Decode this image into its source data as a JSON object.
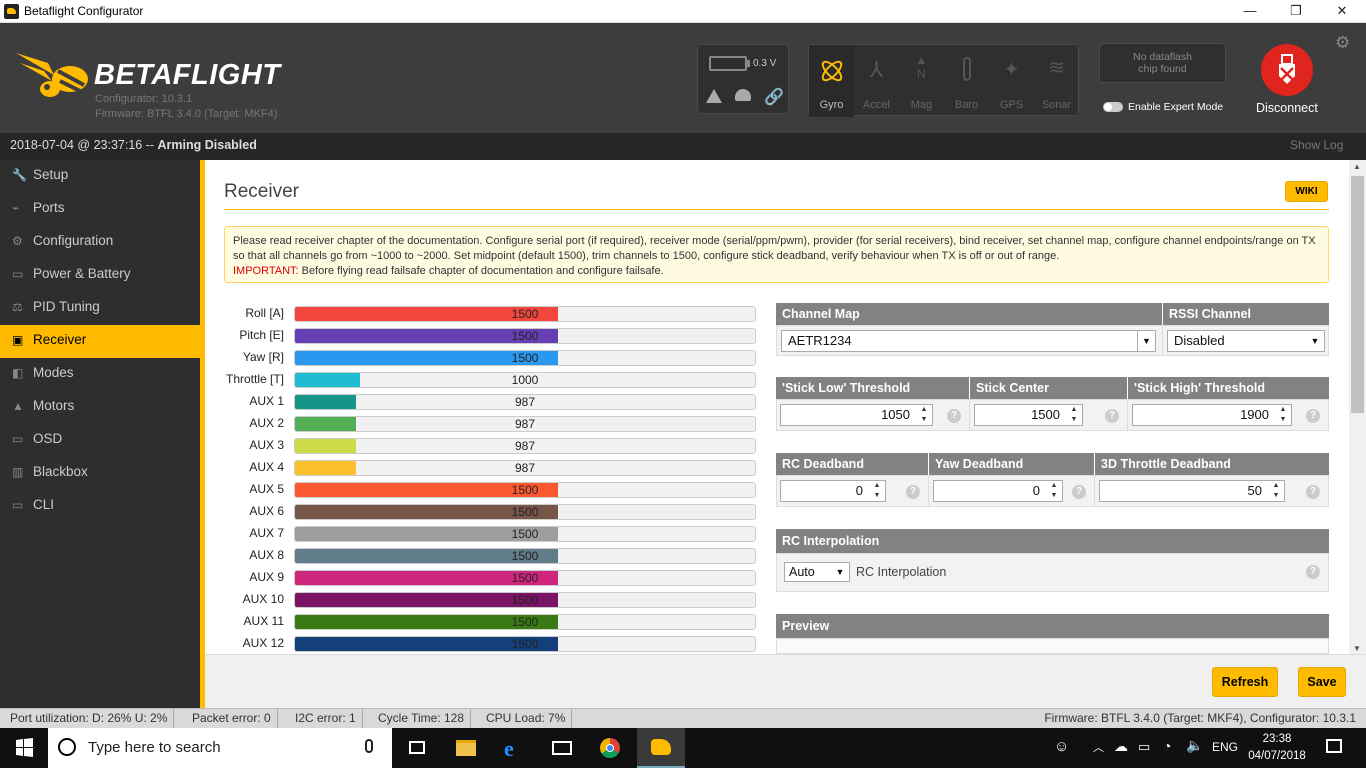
{
  "window": {
    "title": "Betaflight Configurator",
    "minimize": "—",
    "maximize": "❐",
    "close": "✕"
  },
  "header": {
    "logo_main": "BETA",
    "logo_flight": "FLIGHT",
    "configurator_version": "Configurator: 10.3.1",
    "firmware": "Firmware: BTFL 3.4.0 (Target: MKF4)",
    "battery_voltage": "0.3 V",
    "sensors": [
      {
        "label": "Gyro",
        "icon": "gyro-icon",
        "active": true
      },
      {
        "label": "Accel",
        "icon": "accel-icon",
        "active": false
      },
      {
        "label": "Mag",
        "icon": "mag-icon",
        "active": false
      },
      {
        "label": "Baro",
        "icon": "baro-icon",
        "active": false
      },
      {
        "label": "GPS",
        "icon": "gps-icon",
        "active": false
      },
      {
        "label": "Sonar",
        "icon": "sonar-icon",
        "active": false
      }
    ],
    "dataflash_line1": "No dataflash",
    "dataflash_line2": "chip found",
    "expert_mode_label": "Enable Expert Mode",
    "disconnect_label": "Disconnect"
  },
  "status": {
    "datetime": "2018-07-04 @ 23:37:16 -- ",
    "arming": "Arming Disabled",
    "show_log": "Show Log"
  },
  "nav": [
    {
      "label": "Setup",
      "icon": "wrench-icon",
      "glyph": "🔧"
    },
    {
      "label": "Ports",
      "icon": "plug-icon",
      "glyph": "⌁"
    },
    {
      "label": "Configuration",
      "icon": "gear-icon",
      "glyph": "⚙"
    },
    {
      "label": "Power & Battery",
      "icon": "battery-icon",
      "glyph": "▭"
    },
    {
      "label": "PID Tuning",
      "icon": "pid-icon",
      "glyph": "⚖"
    },
    {
      "label": "Receiver",
      "icon": "receiver-icon",
      "glyph": "▣",
      "active": true
    },
    {
      "label": "Modes",
      "icon": "modes-icon",
      "glyph": "◧"
    },
    {
      "label": "Motors",
      "icon": "motor-icon",
      "glyph": "▲"
    },
    {
      "label": "OSD",
      "icon": "osd-icon",
      "glyph": "▭"
    },
    {
      "label": "Blackbox",
      "icon": "blackbox-icon",
      "glyph": "▥"
    },
    {
      "label": "CLI",
      "icon": "cli-icon",
      "glyph": "▭"
    }
  ],
  "receiver": {
    "title": "Receiver",
    "wiki": "WIKI",
    "note_text": "Please read receiver chapter of the documentation. Configure serial port (if required), receiver mode (serial/ppm/pwm), provider (for serial receivers), bind receiver, set channel map, configure channel endpoints/range on TX so that all channels go from ~1000 to ~2000. Set midpoint (default 1500), trim channels to 1500, configure stick deadband, verify behaviour when TX is off or out of range.",
    "note_important": "IMPORTANT:",
    "note_important_text": " Before flying read failsafe chapter of documentation and configure failsafe.",
    "channels": [
      {
        "name": "Roll [A]",
        "value": "1500",
        "level": 0.5,
        "color": "#f1453d"
      },
      {
        "name": "Pitch [E]",
        "value": "1500",
        "level": 0.5,
        "color": "#673fb4"
      },
      {
        "name": "Yaw [R]",
        "value": "1500",
        "level": 0.5,
        "color": "#2b98f0"
      },
      {
        "name": "Throttle [T]",
        "value": "1000",
        "level": 0.0,
        "color": "#1fbcd2"
      },
      {
        "name": "AUX 1",
        "value": "987",
        "level": -0.013,
        "color": "#159588"
      },
      {
        "name": "AUX 2",
        "value": "987",
        "level": -0.013,
        "color": "#50ae55"
      },
      {
        "name": "AUX 3",
        "value": "987",
        "level": -0.013,
        "color": "#cdda49"
      },
      {
        "name": "AUX 4",
        "value": "987",
        "level": -0.013,
        "color": "#fdc02f"
      },
      {
        "name": "AUX 5",
        "value": "1500",
        "level": 0.5,
        "color": "#fc5830"
      },
      {
        "name": "AUX 6",
        "value": "1500",
        "level": 0.5,
        "color": "#785549"
      },
      {
        "name": "AUX 7",
        "value": "1500",
        "level": 0.5,
        "color": "#9e9e9e"
      },
      {
        "name": "AUX 8",
        "value": "1500",
        "level": 0.5,
        "color": "#617d8a"
      },
      {
        "name": "AUX 9",
        "value": "1500",
        "level": 0.5,
        "color": "#cf267d"
      },
      {
        "name": "AUX 10",
        "value": "1500",
        "level": 0.5,
        "color": "#7a1464"
      },
      {
        "name": "AUX 11",
        "value": "1500",
        "level": 0.5,
        "color": "#3a7a14"
      },
      {
        "name": "AUX 12",
        "value": "1500",
        "level": 0.5,
        "color": "#14407a"
      }
    ],
    "channel_map_label": "Channel Map",
    "channel_map_value": "AETR1234",
    "rssi_label": "RSSI Channel",
    "rssi_value": "Disabled",
    "stick_low_label": "'Stick Low' Threshold",
    "stick_low_value": "1050",
    "stick_center_label": "Stick Center",
    "stick_center_value": "1500",
    "stick_high_label": "'Stick High' Threshold",
    "stick_high_value": "1900",
    "rc_deadband_label": "RC Deadband",
    "rc_deadband_value": "0",
    "yaw_deadband_label": "Yaw Deadband",
    "yaw_deadband_value": "0",
    "throttle3d_label": "3D Throttle Deadband",
    "throttle3d_value": "50",
    "interp_header": "RC Interpolation",
    "interp_select": "Auto",
    "interp_label": "RC Interpolation",
    "preview_label": "Preview",
    "help": "?",
    "refresh": "Refresh",
    "save": "Save"
  },
  "footer": {
    "port_util": "Port utilization: D: 26% U: 2%",
    "packet_error": "Packet error: 0",
    "i2c_error": "I2C error: 1",
    "cycle_time": "Cycle Time: 128",
    "cpu_load": "CPU Load: 7%",
    "firmware_info": "Firmware: BTFL 3.4.0 (Target: MKF4), Configurator: 10.3.1"
  },
  "taskbar": {
    "search_placeholder": "Type here to search",
    "lang": "ENG",
    "time": "23:38",
    "date": "04/07/2018"
  }
}
